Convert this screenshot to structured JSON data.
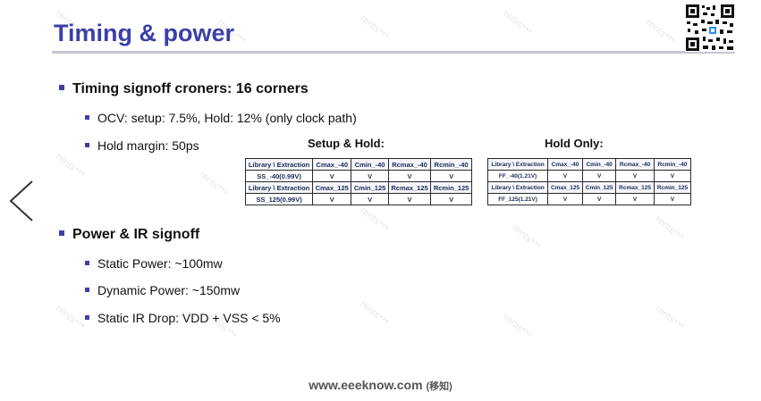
{
  "slide": {
    "title": "Timing & power",
    "qr_icon": "qr-code-icon"
  },
  "timing": {
    "heading": "Timing signoff croners: 16 corners",
    "items": [
      "OCV: setup: 7.5%, Hold: 12% (only clock path)",
      "Hold margin: 50ps"
    ]
  },
  "tables": {
    "setup_hold": {
      "title": "Setup & Hold:",
      "rows": [
        [
          "Library \\ Extraction",
          "Cmax_-40",
          "Cmin_-40",
          "Rcmax_-40",
          "Rcmin_-40"
        ],
        [
          "SS_-40(0.99V)",
          "V",
          "V",
          "V",
          "V"
        ],
        [
          "Library \\ Extraction",
          "Cmax_125",
          "Cmin_125",
          "Rcmax_125",
          "Rcmin_125"
        ],
        [
          "SS_125(0.99V)",
          "V",
          "V",
          "V",
          "V"
        ]
      ]
    },
    "hold_only": {
      "title": "Hold Only:",
      "rows": [
        [
          "Library \\ Extraction",
          "Cmax_-40",
          "Cmin_-40",
          "Rcmax_-40",
          "Rcmin_-40"
        ],
        [
          "FF_-40(1.21V)",
          "V",
          "V",
          "V",
          "V"
        ],
        [
          "Library \\ Extraction",
          "Cmax_125",
          "Cmin_125",
          "Rcmax_125",
          "Rcmin_125"
        ],
        [
          "FF_125(1.21V)",
          "V",
          "V",
          "V",
          "V"
        ]
      ]
    }
  },
  "power": {
    "heading": "Power & IR signoff",
    "items": [
      "Static Power: ~100mw",
      "Dynamic Power: ~150mw",
      "Static IR Drop: VDD + VSS < 5%"
    ]
  },
  "footer": {
    "site": "www.eeeknow.com",
    "tag": "(移知)"
  },
  "nav": {
    "back_icon": "chevron-left-icon"
  },
  "colors": {
    "title": "#3b3fa8",
    "bullet": "#3b3fa8",
    "table_text": "#1c2a55"
  }
}
